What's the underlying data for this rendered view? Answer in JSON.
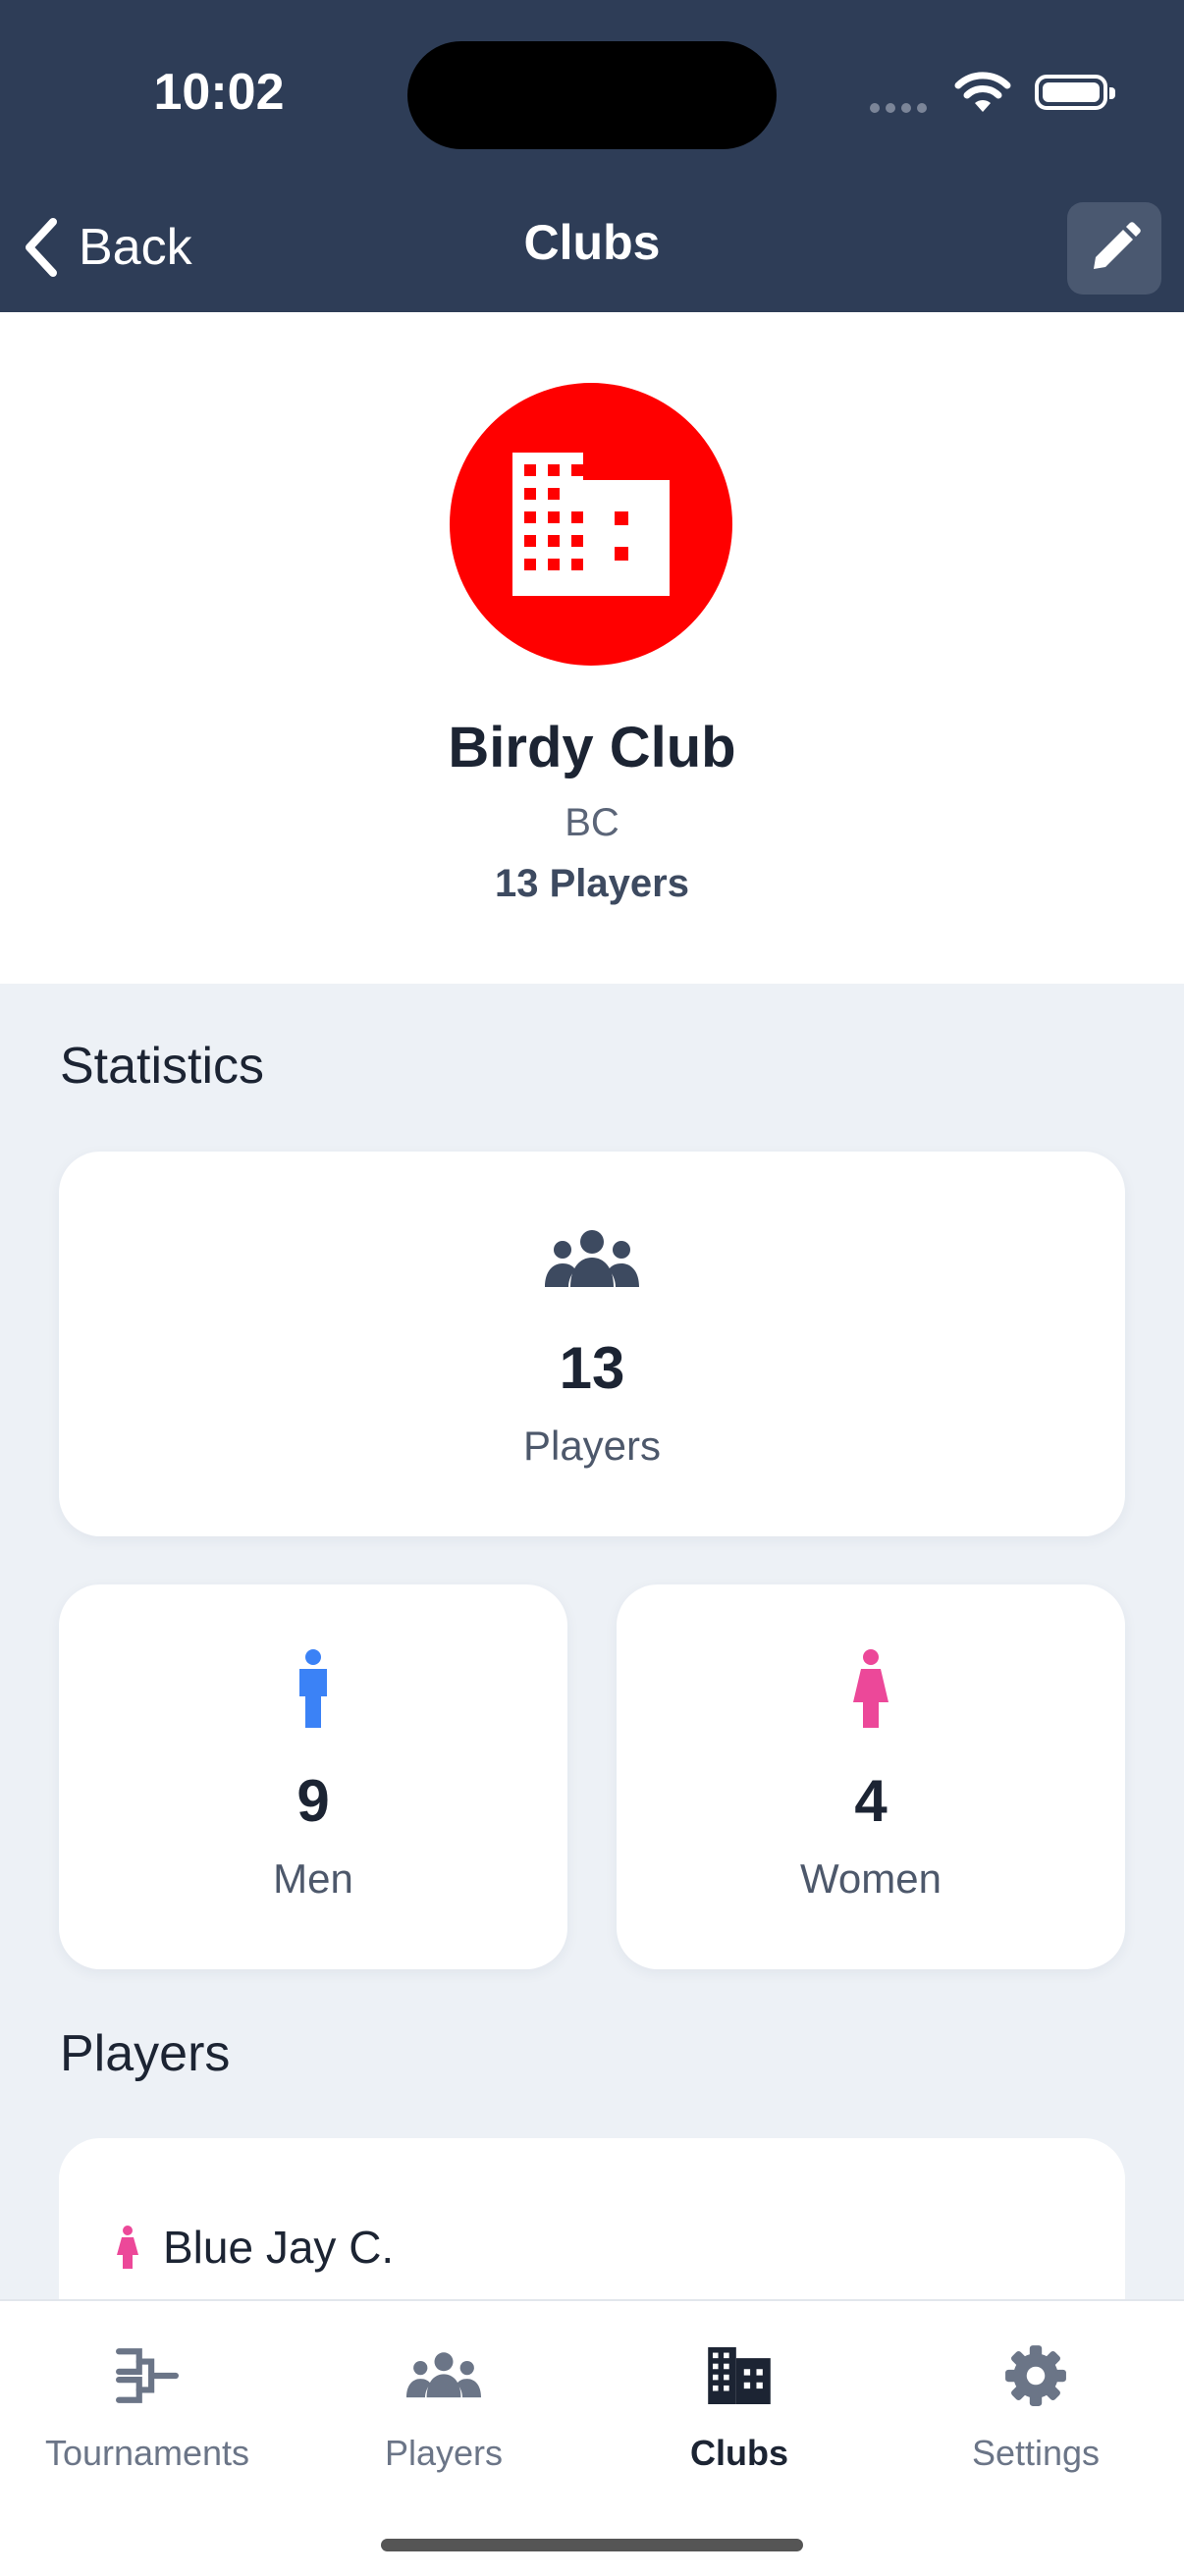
{
  "status_bar": {
    "time": "10:02"
  },
  "nav": {
    "back_label": "Back",
    "title": "Clubs",
    "edit_icon": "pencil-icon"
  },
  "club": {
    "name": "Birdy Club",
    "abbreviation": "BC",
    "player_count_label": "13 Players",
    "logo_icon": "building-icon",
    "logo_color": "#ff0000"
  },
  "statistics": {
    "section_title": "Statistics",
    "players": {
      "value": "13",
      "label": "Players",
      "icon": "users-icon"
    },
    "men": {
      "value": "9",
      "label": "Men",
      "icon": "male-icon",
      "color": "#3b82f6"
    },
    "women": {
      "value": "4",
      "label": "Women",
      "icon": "female-icon",
      "color": "#ec4899"
    }
  },
  "players_section": {
    "section_title": "Players",
    "items": [
      {
        "name": "Blue Jay C.",
        "gender_icon": "female-icon"
      }
    ]
  },
  "tab_bar": {
    "tabs": [
      {
        "label": "Tournaments",
        "icon": "bracket-icon",
        "active": false
      },
      {
        "label": "Players",
        "icon": "users-icon",
        "active": false
      },
      {
        "label": "Clubs",
        "icon": "building-icon",
        "active": true
      },
      {
        "label": "Settings",
        "icon": "gear-icon",
        "active": false
      }
    ]
  },
  "colors": {
    "header_bg": "#2e3d57",
    "page_bg": "#edf1f6",
    "text_dark": "#1c2433"
  }
}
